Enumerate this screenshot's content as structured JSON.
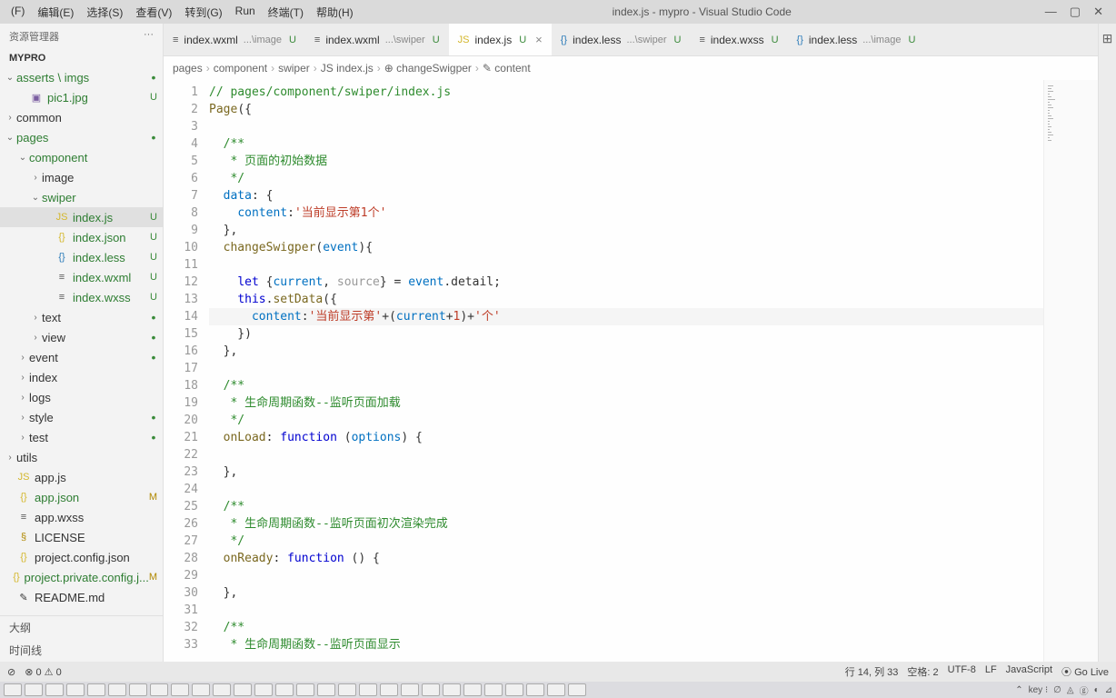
{
  "window": {
    "title": "index.js - mypro - Visual Studio Code"
  },
  "menu": [
    "(F)",
    "编辑(E)",
    "选择(S)",
    "查看(V)",
    "转到(G)",
    "Run",
    "终端(T)",
    "帮助(H)"
  ],
  "sidebar": {
    "title": "资源管理器",
    "more": "···",
    "project": "MYPRO",
    "tree": [
      {
        "name": "asserts \\ imgs",
        "type": "folder",
        "open": true,
        "depth": 0,
        "dot": true
      },
      {
        "name": "pic1.jpg",
        "type": "img",
        "depth": 1,
        "badge": "U"
      },
      {
        "name": "common",
        "type": "folder",
        "open": false,
        "depth": 0
      },
      {
        "name": "pages",
        "type": "folder",
        "open": true,
        "depth": 0,
        "dot": true
      },
      {
        "name": "component",
        "type": "folder",
        "open": true,
        "depth": 1
      },
      {
        "name": "image",
        "type": "folder",
        "open": false,
        "depth": 2
      },
      {
        "name": "swiper",
        "type": "folder",
        "open": true,
        "depth": 2
      },
      {
        "name": "index.js",
        "type": "js",
        "depth": 3,
        "badge": "U",
        "active": true
      },
      {
        "name": "index.json",
        "type": "json",
        "depth": 3,
        "badge": "U"
      },
      {
        "name": "index.less",
        "type": "less",
        "depth": 3,
        "badge": "U"
      },
      {
        "name": "index.wxml",
        "type": "wxml",
        "depth": 3,
        "badge": "U"
      },
      {
        "name": "index.wxss",
        "type": "wxml",
        "depth": 3,
        "badge": "U"
      },
      {
        "name": "text",
        "type": "folder",
        "open": false,
        "depth": 2,
        "dot": true
      },
      {
        "name": "view",
        "type": "folder",
        "open": false,
        "depth": 2,
        "dot": true
      },
      {
        "name": "event",
        "type": "folder",
        "open": false,
        "depth": 1,
        "dot": true
      },
      {
        "name": "index",
        "type": "folder",
        "open": false,
        "depth": 1
      },
      {
        "name": "logs",
        "type": "folder",
        "open": false,
        "depth": 1
      },
      {
        "name": "style",
        "type": "folder",
        "open": false,
        "depth": 1,
        "dot": true
      },
      {
        "name": "test",
        "type": "folder",
        "open": false,
        "depth": 1,
        "dot": true
      },
      {
        "name": "utils",
        "type": "folder",
        "open": false,
        "depth": 0
      },
      {
        "name": "app.js",
        "type": "js",
        "depth": 0
      },
      {
        "name": "app.json",
        "type": "json",
        "depth": 0,
        "badge": "M"
      },
      {
        "name": "app.wxss",
        "type": "wxml",
        "depth": 0
      },
      {
        "name": "LICENSE",
        "type": "lic",
        "depth": 0
      },
      {
        "name": "project.config.json",
        "type": "json",
        "depth": 0
      },
      {
        "name": "project.private.config.j...",
        "type": "json",
        "depth": 0,
        "badge": "M"
      },
      {
        "name": "README.md",
        "type": "md",
        "depth": 0
      }
    ],
    "outline": "大纲",
    "timeline": "时间线"
  },
  "tabs": [
    {
      "icon": "wxml",
      "name": "index.wxml",
      "path": "...\\image",
      "status": "U"
    },
    {
      "icon": "wxml",
      "name": "index.wxml",
      "path": "...\\swiper",
      "status": "U"
    },
    {
      "icon": "js",
      "name": "index.js",
      "status": "U",
      "active": true,
      "close": true
    },
    {
      "icon": "less",
      "name": "index.less",
      "path": "...\\swiper",
      "status": "U"
    },
    {
      "icon": "wxml",
      "name": "index.wxss",
      "status": "U"
    },
    {
      "icon": "less",
      "name": "index.less",
      "path": "...\\image",
      "status": "U"
    }
  ],
  "breadcrumbs": [
    "pages",
    "component",
    "swiper",
    "JS index.js",
    "⊕ changeSwigper",
    "✎ content"
  ],
  "code": {
    "lines": [
      {
        "n": 1,
        "html": "<span class='c-comment'>// pages/component/swiper/index.js</span>"
      },
      {
        "n": 2,
        "html": "<span class='c-fn'>Page</span>({"
      },
      {
        "n": 3,
        "html": ""
      },
      {
        "n": 4,
        "html": "  <span class='c-comment'>/**</span>"
      },
      {
        "n": 5,
        "html": "   <span class='c-comment'>* 页面的初始数据</span>"
      },
      {
        "n": 6,
        "html": "   <span class='c-comment'>*/</span>"
      },
      {
        "n": 7,
        "html": "  <span class='c-param'>data</span>: {"
      },
      {
        "n": 8,
        "html": "    <span class='c-param'>content</span>:<span class='c-str'>'当前显示第1个'</span>"
      },
      {
        "n": 9,
        "html": "  },"
      },
      {
        "n": 10,
        "html": "  <span class='c-fn'>changeSwigper</span>(<span class='c-param'>event</span>){"
      },
      {
        "n": 11,
        "html": ""
      },
      {
        "n": 12,
        "html": "    <span class='c-key'>let</span> {<span class='c-param'>current</span>, <span class='c-dim'>source</span>} = <span class='c-param'>event</span>.detail;"
      },
      {
        "n": 13,
        "html": "    <span class='c-key'>this</span>.<span class='c-fn'>setData</span>({"
      },
      {
        "n": 14,
        "html": "      <span class='c-param'>content</span>:<span class='c-str'>'当前显示第'</span>+(<span class='c-param'>current</span>+<span class='c-str'>1</span>)+<span class='c-str'>'个'</span>",
        "hl": true
      },
      {
        "n": 15,
        "html": "    })"
      },
      {
        "n": 16,
        "html": "  },"
      },
      {
        "n": 17,
        "html": ""
      },
      {
        "n": 18,
        "html": "  <span class='c-comment'>/**</span>"
      },
      {
        "n": 19,
        "html": "   <span class='c-comment'>* 生命周期函数--监听页面加载</span>"
      },
      {
        "n": 20,
        "html": "   <span class='c-comment'>*/</span>"
      },
      {
        "n": 21,
        "html": "  <span class='c-fn'>onLoad</span>: <span class='c-key'>function</span> (<span class='c-param'>options</span>) {"
      },
      {
        "n": 22,
        "html": ""
      },
      {
        "n": 23,
        "html": "  },"
      },
      {
        "n": 24,
        "html": ""
      },
      {
        "n": 25,
        "html": "  <span class='c-comment'>/**</span>"
      },
      {
        "n": 26,
        "html": "   <span class='c-comment'>* 生命周期函数--监听页面初次渲染完成</span>"
      },
      {
        "n": 27,
        "html": "   <span class='c-comment'>*/</span>"
      },
      {
        "n": 28,
        "html": "  <span class='c-fn'>onReady</span>: <span class='c-key'>function</span> () {"
      },
      {
        "n": 29,
        "html": ""
      },
      {
        "n": 30,
        "html": "  },"
      },
      {
        "n": 31,
        "html": ""
      },
      {
        "n": 32,
        "html": "  <span class='c-comment'>/**</span>"
      },
      {
        "n": 33,
        "html": "   <span class='c-comment'>* 生命周期函数--监听页面显示</span>"
      }
    ]
  },
  "statusbar": {
    "left": [
      "⊘",
      "⊗ 0 ⚠ 0"
    ],
    "right": [
      "行 14, 列 33",
      "空格: 2",
      "UTF-8",
      "LF",
      "JavaScript",
      "⦿ Go Live"
    ]
  },
  "taskbar": {
    "right": [
      "⌃",
      "key ⁝",
      "∅",
      "◬",
      "ⓖ",
      "◐",
      "⊿"
    ]
  }
}
